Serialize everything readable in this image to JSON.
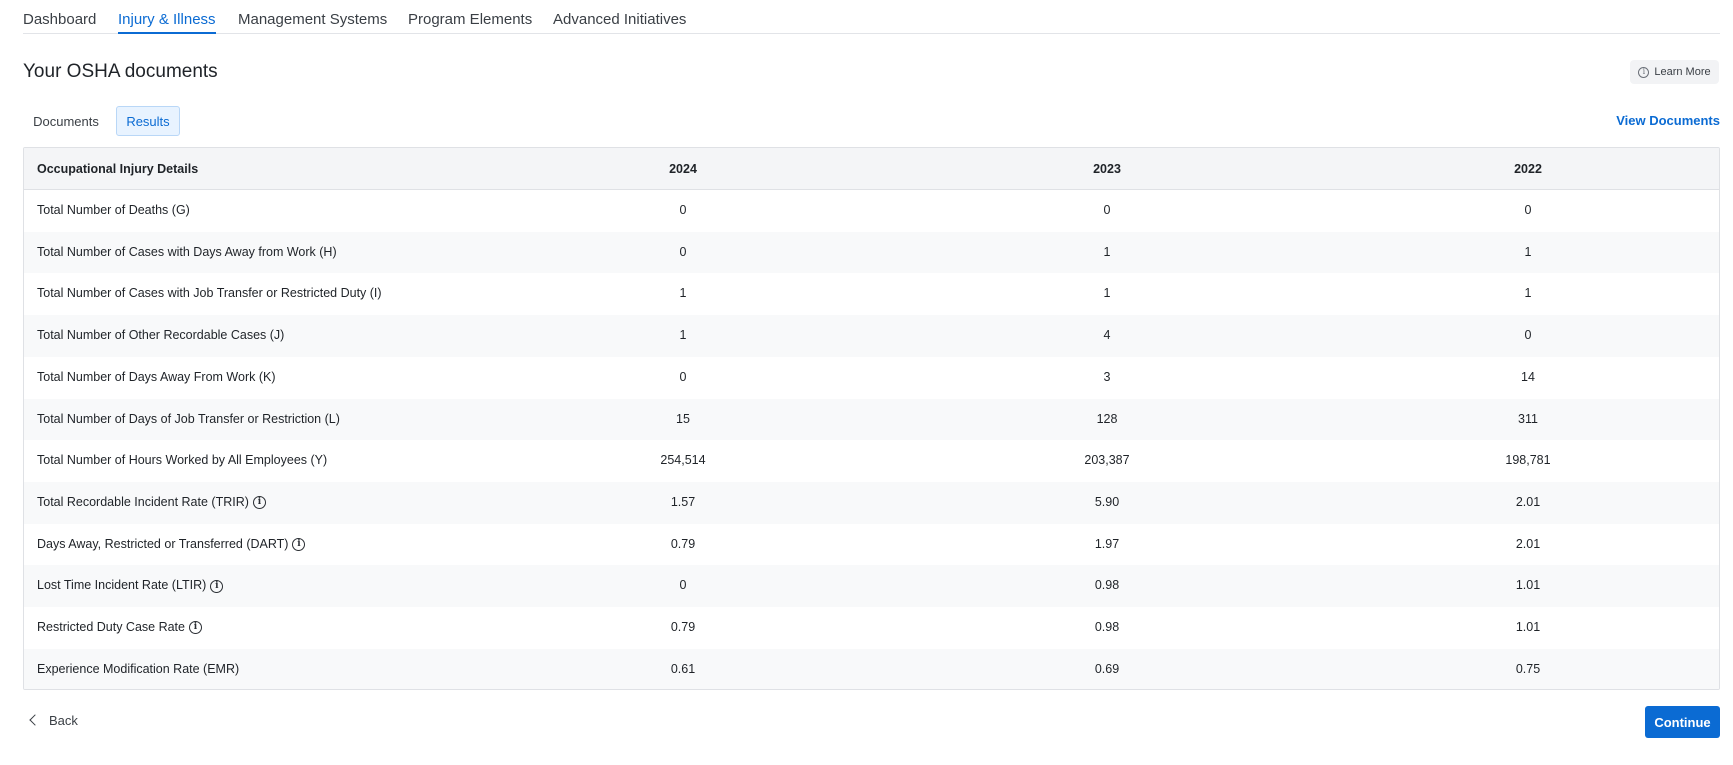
{
  "nav": {
    "tabs": [
      {
        "label": "Dashboard"
      },
      {
        "label": "Injury & Illness"
      },
      {
        "label": "Management Systems"
      },
      {
        "label": "Program Elements"
      },
      {
        "label": "Advanced Initiatives"
      }
    ],
    "active_tab": "Injury & Illness"
  },
  "page": {
    "title": "Your OSHA documents",
    "learn_more_label": "Learn More",
    "subtabs": [
      {
        "label": "Documents"
      },
      {
        "label": "Results"
      }
    ],
    "active_subtab": "Results",
    "view_documents_label": "View Documents"
  },
  "table": {
    "header": {
      "label": "Occupational Injury Details",
      "years": [
        "2024",
        "2023",
        "2022"
      ]
    },
    "rows": [
      {
        "label": "Total Number of Deaths (G)",
        "info": false,
        "values": [
          "0",
          "0",
          "0"
        ]
      },
      {
        "label": "Total Number of Cases with Days Away from Work (H)",
        "info": false,
        "values": [
          "0",
          "1",
          "1"
        ]
      },
      {
        "label": "Total Number of Cases with Job Transfer or Restricted Duty (I)",
        "info": false,
        "values": [
          "1",
          "1",
          "1"
        ]
      },
      {
        "label": "Total Number of Other Recordable Cases (J)",
        "info": false,
        "values": [
          "1",
          "4",
          "0"
        ]
      },
      {
        "label": "Total Number of Days Away From Work (K)",
        "info": false,
        "values": [
          "0",
          "3",
          "14"
        ]
      },
      {
        "label": "Total Number of Days of Job Transfer or Restriction (L)",
        "info": false,
        "values": [
          "15",
          "128",
          "311"
        ]
      },
      {
        "label": "Total Number of Hours Worked by All Employees (Y)",
        "info": false,
        "values": [
          "254,514",
          "203,387",
          "198,781"
        ]
      },
      {
        "label": "Total Recordable Incident Rate (TRIR)",
        "info": true,
        "values": [
          "1.57",
          "5.90",
          "2.01"
        ]
      },
      {
        "label": "Days Away, Restricted or Transferred (DART)",
        "info": true,
        "values": [
          "0.79",
          "1.97",
          "2.01"
        ]
      },
      {
        "label": "Lost Time Incident Rate (LTIR)",
        "info": true,
        "values": [
          "0",
          "0.98",
          "1.01"
        ]
      },
      {
        "label": "Restricted Duty Case Rate",
        "info": true,
        "values": [
          "0.79",
          "0.98",
          "1.01"
        ]
      },
      {
        "label": "Experience Modification Rate (EMR)",
        "info": false,
        "values": [
          "0.61",
          "0.69",
          "0.75"
        ]
      }
    ]
  },
  "footer": {
    "back_label": "Back",
    "continue_label": "Continue"
  },
  "icons": {
    "info": "info-circle-icon",
    "back": "chevron-left-icon"
  },
  "colors": {
    "accent": "#0b6bd3",
    "active_subtab_bg": "#e8f3ff"
  }
}
